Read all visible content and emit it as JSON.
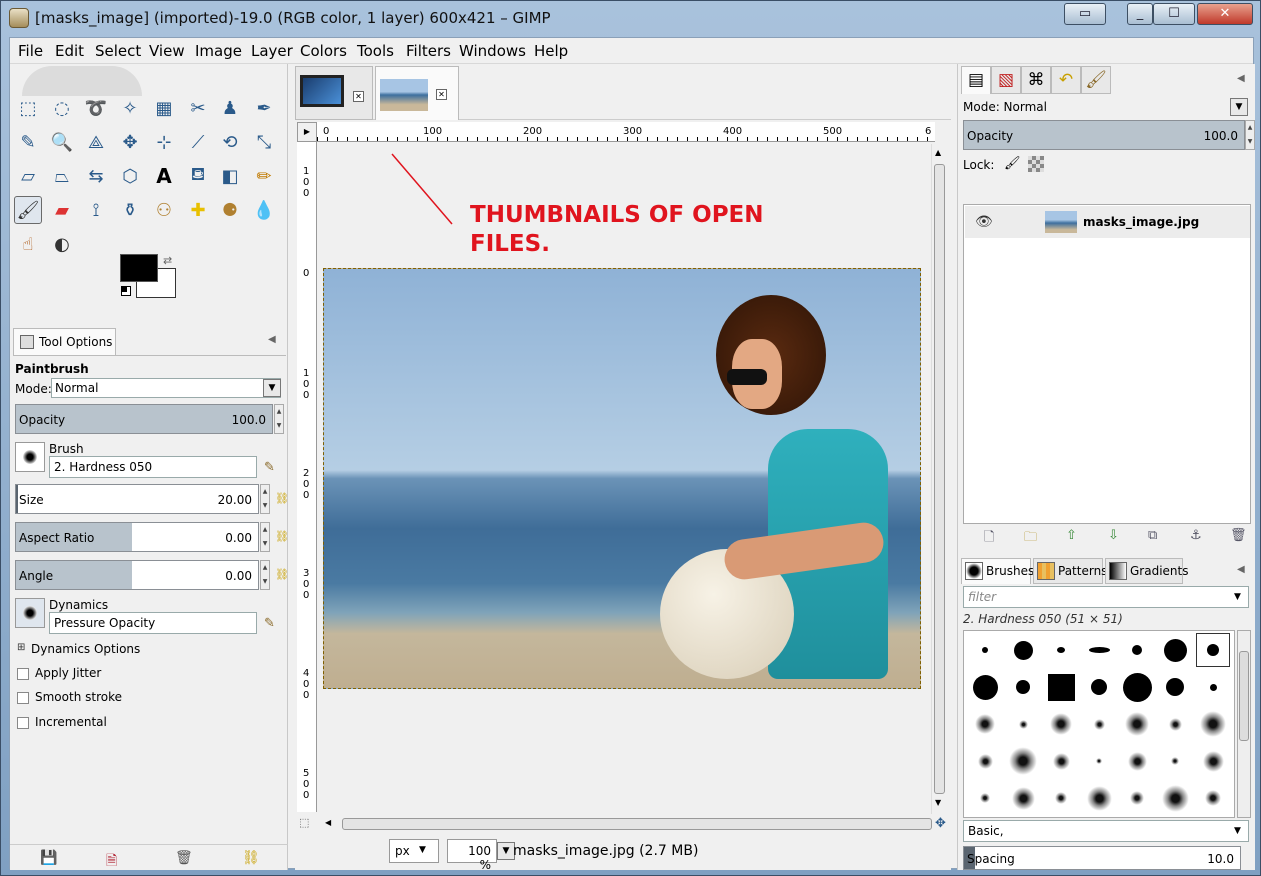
{
  "window": {
    "title": "[masks_image] (imported)-19.0 (RGB color, 1 layer) 600x421 – GIMP",
    "min": "▭",
    "max": "☐",
    "close": "✕"
  },
  "menu": [
    "File",
    "Edit",
    "Select",
    "View",
    "Image",
    "Layer",
    "Colors",
    "Tools",
    "Filters",
    "Windows",
    "Help"
  ],
  "tool_options": {
    "tab_label": "Tool Options",
    "tool_name": "Paintbrush",
    "mode_label": "Mode:",
    "mode_value": "Normal",
    "opacity_label": "Opacity",
    "opacity_value": "100.0",
    "brush_label": "Brush",
    "brush_value": "2. Hardness 050",
    "size_label": "Size",
    "size_value": "20.00",
    "aspect_label": "Aspect Ratio",
    "aspect_value": "0.00",
    "angle_label": "Angle",
    "angle_value": "0.00",
    "dynamics_label": "Dynamics",
    "dynamics_value": "Pressure Opacity",
    "dynamics_options": "Dynamics Options",
    "apply_jitter": "Apply Jitter",
    "smooth_stroke": "Smooth stroke",
    "incremental": "Incremental"
  },
  "image_window": {
    "annotation": [
      "THUMBNAILS OF OPEN",
      "FILES."
    ],
    "ruler_h": [
      "0",
      "100",
      "200",
      "300",
      "400",
      "500",
      "6"
    ],
    "ruler_v": [
      [
        "1",
        "0",
        "0"
      ],
      [
        "0"
      ],
      [
        "1",
        "0",
        "0"
      ],
      [
        "2",
        "0",
        "0"
      ],
      [
        "3",
        "0",
        "0"
      ],
      [
        "4",
        "0",
        "0"
      ],
      [
        "5",
        "0",
        "0"
      ]
    ],
    "unit": "px",
    "zoom": "100 %",
    "status": "masks_image.jpg (2.7 MB)"
  },
  "layers": {
    "mode_label": "Mode: Normal",
    "opacity_label": "Opacity",
    "opacity_value": "100.0",
    "lock_label": "Lock:",
    "layer_name": "masks_image.jpg"
  },
  "brushes": {
    "tabs": [
      "Brushes",
      "Patterns",
      "Gradients"
    ],
    "filter_placeholder": "filter",
    "selected": "2. Hardness 050 (51 × 51)",
    "tag": "Basic,",
    "spacing_label": "Spacing",
    "spacing_value": "10.0"
  }
}
